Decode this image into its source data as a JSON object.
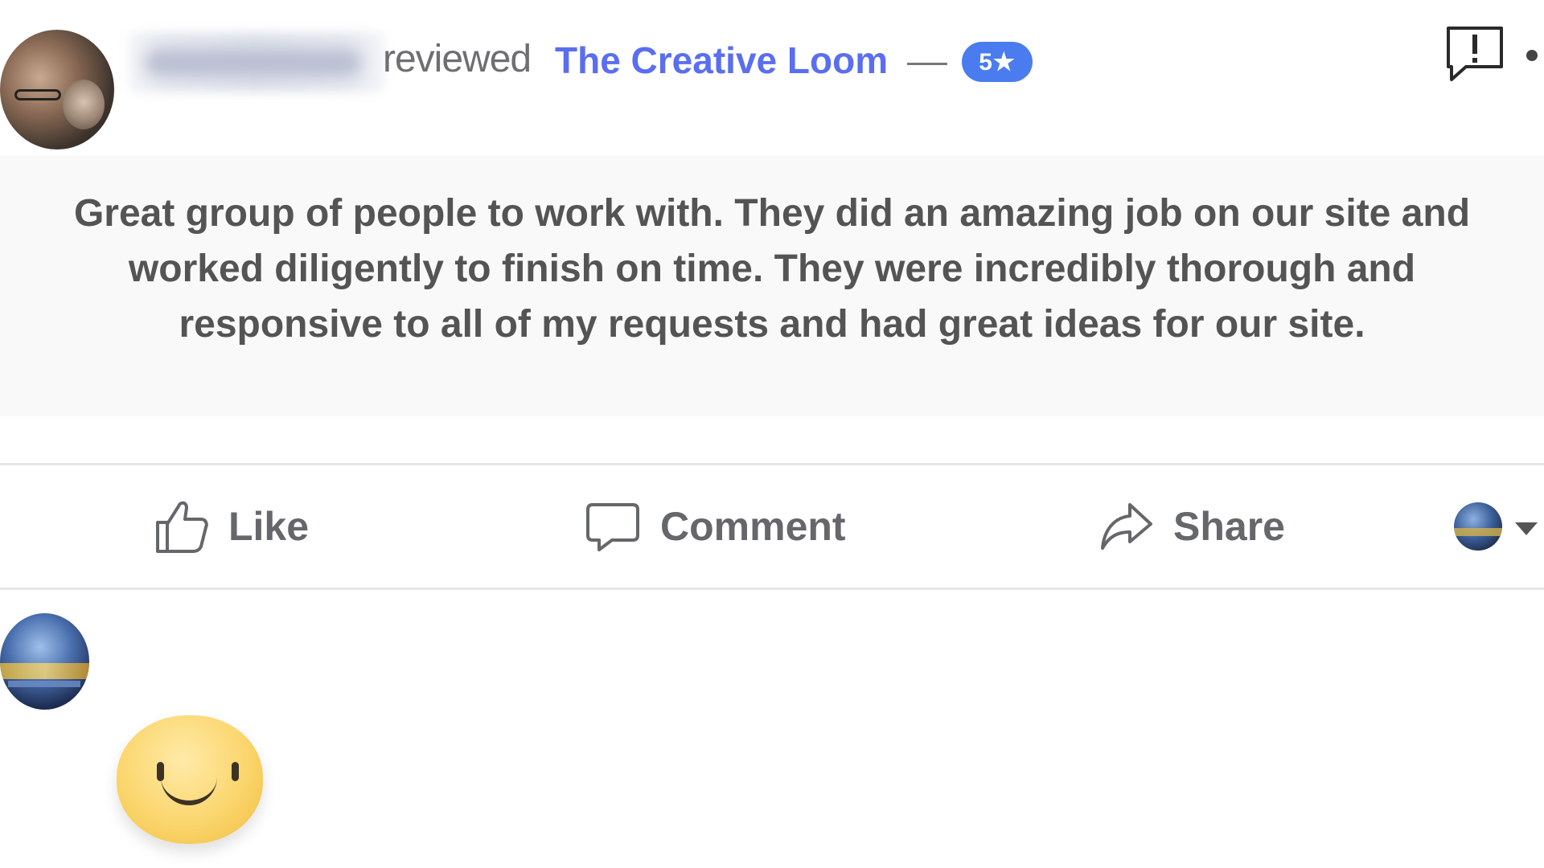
{
  "header": {
    "author_name_blurred": "",
    "reviewed_text": "reviewed",
    "page_name": "The Creative Loom",
    "separator": "—",
    "rating_badge": "5★"
  },
  "review": {
    "text": "Great group of people to work with. They did an amazing job on our site and worked diligently to finish on time. They were incredibly thorough and responsive to all of my requests and had great ideas for our site."
  },
  "actions": {
    "like_label": "Like",
    "comment_label": "Comment",
    "share_label": "Share"
  },
  "colors": {
    "link_blue": "#5a6ef0",
    "badge_blue": "#4a7cf0",
    "text_gray": "#545454",
    "action_gray": "#66676b"
  },
  "icons": {
    "like": "thumbs-up-icon",
    "comment": "speech-bubble-icon",
    "share": "share-arrow-icon",
    "report": "report-flag-icon"
  }
}
